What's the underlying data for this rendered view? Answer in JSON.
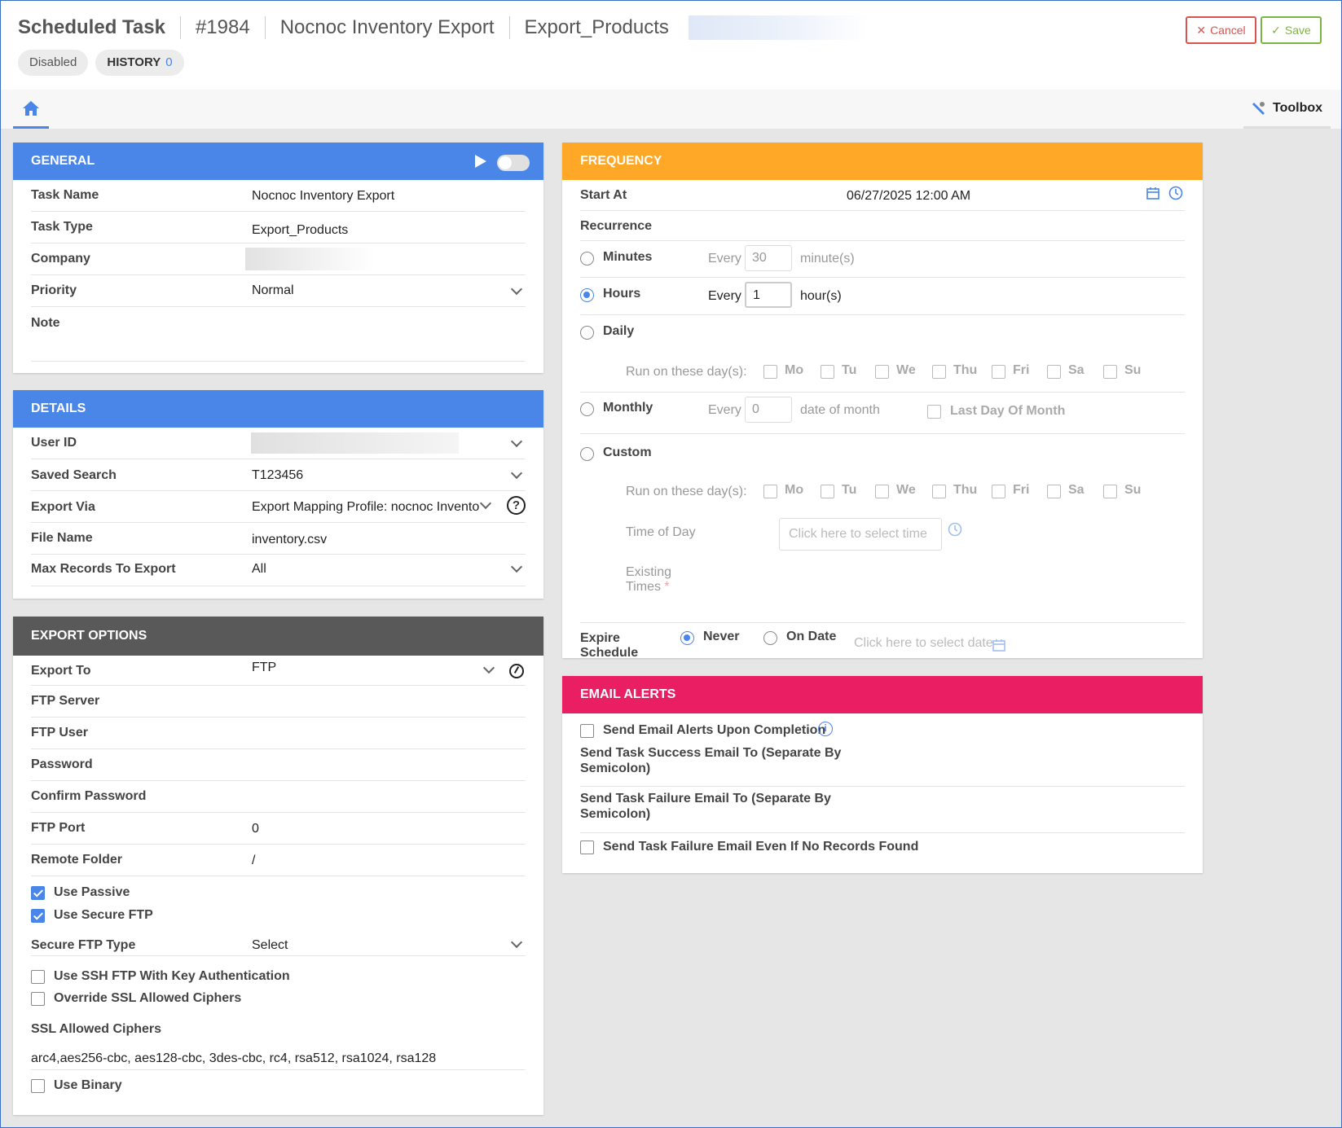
{
  "header": {
    "title": "Scheduled Task",
    "id": "#1984",
    "task_name": "Nocnoc Inventory Export",
    "task_type": "Export_Products",
    "status": "Disabled",
    "history_label": "HISTORY",
    "history_count": "0",
    "cancel_label": "Cancel",
    "save_label": "Save"
  },
  "tabs": {
    "toolbox_label": "Toolbox"
  },
  "general": {
    "title": "GENERAL",
    "task_name_label": "Task Name",
    "task_name_value": "Nocnoc Inventory Export",
    "task_type_label": "Task Type",
    "task_type_value": "Export_Products",
    "company_label": "Company",
    "priority_label": "Priority",
    "priority_value": "Normal",
    "note_label": "Note"
  },
  "details": {
    "title": "DETAILS",
    "user_id_label": "User ID",
    "saved_search_label": "Saved Search",
    "saved_search_value": "T123456",
    "export_via_label": "Export Via",
    "export_via_value": "Export Mapping Profile: nocnoc Inventor",
    "file_name_label": "File Name",
    "file_name_value": "inventory.csv",
    "max_records_label": "Max Records To Export",
    "max_records_value": "All"
  },
  "export_options": {
    "title": "EXPORT OPTIONS",
    "export_to_label": "Export To",
    "export_to_value": "FTP",
    "ftp_server_label": "FTP Server",
    "ftp_user_label": "FTP User",
    "password_label": "Password",
    "confirm_password_label": "Confirm Password",
    "ftp_port_label": "FTP Port",
    "ftp_port_value": "0",
    "remote_folder_label": "Remote Folder",
    "remote_folder_value": "/",
    "use_passive_label": "Use Passive",
    "use_secure_ftp_label": "Use Secure FTP",
    "secure_ftp_type_label": "Secure FTP Type",
    "secure_ftp_type_value": "Select",
    "use_ssh_label": "Use SSH FTP With Key Authentication",
    "override_ssl_label": "Override SSL Allowed Ciphers",
    "ssl_ciphers_label": "SSL Allowed Ciphers",
    "ssl_ciphers_value": "arc4,aes256-cbc, aes128-cbc, 3des-cbc, rc4, rsa512, rsa1024, rsa128",
    "use_binary_label": "Use Binary"
  },
  "frequency": {
    "title": "FREQUENCY",
    "start_at_label": "Start At",
    "start_at_value": "06/27/2025 12:00 AM",
    "recurrence_label": "Recurrence",
    "minutes_label": "Minutes",
    "every_label": "Every",
    "minutes_value": "30",
    "minutes_unit": "minute(s)",
    "hours_label": "Hours",
    "hours_value": "1",
    "hours_unit": "hour(s)",
    "daily_label": "Daily",
    "run_days_label": "Run on these day(s):",
    "days": [
      "Mo",
      "Tu",
      "We",
      "Thu",
      "Fri",
      "Sa",
      "Su"
    ],
    "monthly_label": "Monthly",
    "monthly_value": "0",
    "monthly_unit": "date of month",
    "last_day_label": "Last Day Of Month",
    "custom_label": "Custom",
    "time_of_day_label": "Time of Day",
    "time_placeholder": "Click here to select time",
    "existing_times_label": "Existing",
    "existing_times_label2": "Times",
    "expire_label": "Expire",
    "expire_label2": "Schedule",
    "never_label": "Never",
    "on_date_label": "On Date",
    "date_placeholder": "Click here to select date"
  },
  "email": {
    "title": "EMAIL ALERTS",
    "send_alerts_label": "Send Email Alerts Upon Completion",
    "success_label": "Send Task Success Email To (Separate By",
    "success_label2": "Semicolon)",
    "failure_label": "Send Task Failure Email To (Separate By",
    "failure_label2": "Semicolon)",
    "no_records_label": "Send Task Failure Email Even If No Records Found"
  },
  "colors": {
    "accent": "#4a86e8",
    "frequency": "#ffa726",
    "email": "#e91e63",
    "dark": "#595959"
  }
}
